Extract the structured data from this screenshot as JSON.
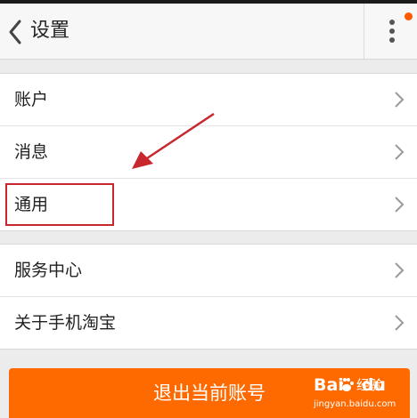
{
  "header": {
    "title": "设置",
    "back_icon": "chevron-left-icon",
    "more_icon": "more-vertical-icon",
    "notification_color": "#ff5a00"
  },
  "group1": {
    "items": [
      {
        "label": "账户"
      },
      {
        "label": "消息"
      },
      {
        "label": "通用"
      }
    ]
  },
  "group2": {
    "items": [
      {
        "label": "服务中心"
      },
      {
        "label": "关于手机淘宝"
      }
    ]
  },
  "annotation": {
    "highlight_color": "#c9272e",
    "highlighted_item": "通用"
  },
  "logout": {
    "label": "退出当前账号",
    "color": "#ff6a00"
  },
  "watermark": {
    "brand": "Bai",
    "brand_suffix": "du",
    "text": "经验",
    "url": "jingyan.baidu.com"
  }
}
